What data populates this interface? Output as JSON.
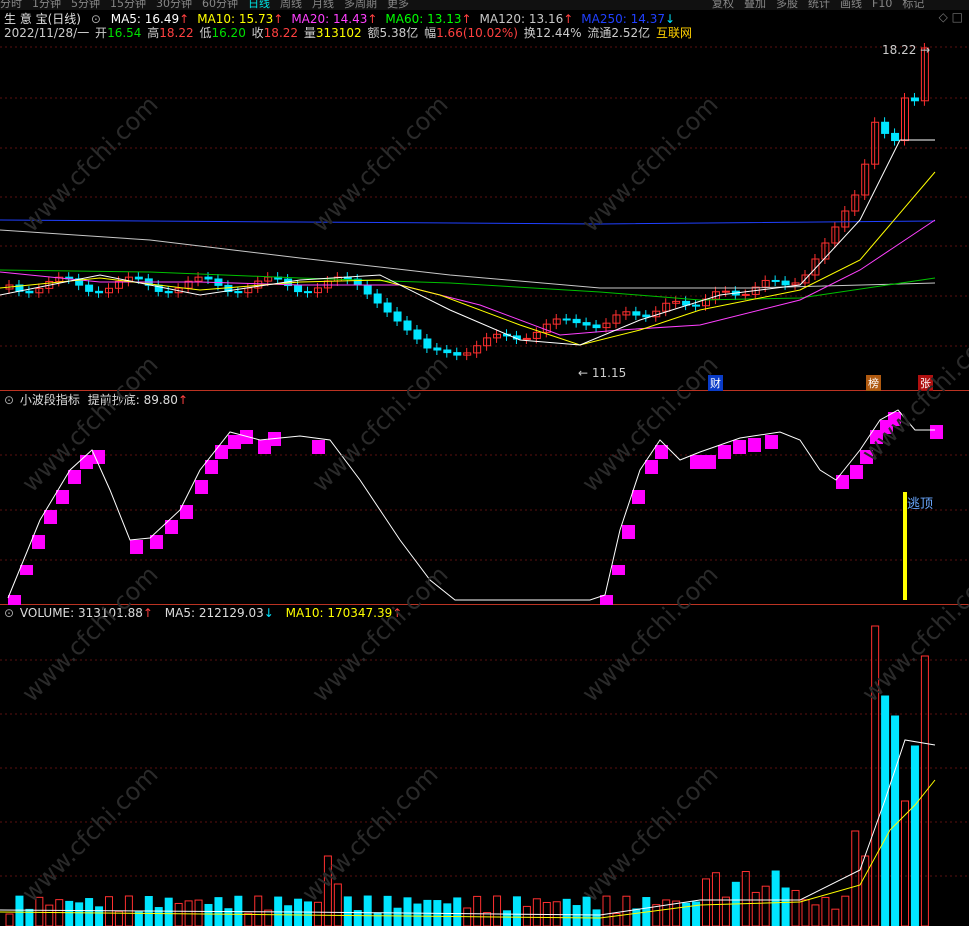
{
  "topbar": {
    "tabs": [
      "分时",
      "1分钟",
      "5分钟",
      "15分钟",
      "30分钟",
      "60分钟",
      "日线",
      "周线",
      "月线",
      "多周期",
      "更多"
    ],
    "right_tabs": [
      "复权",
      "叠加",
      "多股",
      "统计",
      "画线",
      "F10",
      "标记"
    ]
  },
  "header": {
    "stock_name": "生 意 宝(日线)",
    "ma": [
      {
        "label": "MA5: 16.49",
        "arrow": "↑",
        "color": "#ffffff"
      },
      {
        "label": "MA10: 15.73",
        "arrow": "↑",
        "color": "#ffff00"
      },
      {
        "label": "MA20: 14.43",
        "arrow": "↑",
        "color": "#ff40ff"
      },
      {
        "label": "MA60: 13.13",
        "arrow": "↑",
        "color": "#00ff00"
      },
      {
        "label": "MA120: 13.16",
        "arrow": "↑",
        "color": "#c8c8c8"
      },
      {
        "label": "MA250: 14.37",
        "arrow": "↓",
        "color": "#2040ff"
      }
    ]
  },
  "quote": {
    "date": "2022/11/28/一",
    "open_label": "开",
    "open": "16.54",
    "high_label": "高",
    "high": "18.22",
    "low_label": "低",
    "low": "16.20",
    "close_label": "收",
    "close": "18.22",
    "vol_label": "量",
    "vol": "313102",
    "amount_label": "额",
    "amount": "5.38亿",
    "chg_label": "幅",
    "chg": "1.66(10.02%)",
    "turnover_label": "换",
    "turnover": "12.44%",
    "float_label": "流通",
    "float": "2.52亿",
    "source": "互联网"
  },
  "price_chart": {
    "high_marker": "18.22",
    "low_marker": "11.15",
    "badges": [
      "财",
      "榜",
      "张"
    ]
  },
  "indicator": {
    "title": "小波段指标",
    "subtitle": "提前抄底: 89.80",
    "arrow": "↑",
    "signal_label": "逃顶"
  },
  "volume": {
    "label": "VOLUME: 313101.88",
    "ma5": "MA5: 212129.03",
    "ma5_arrow": "↓",
    "ma10": "MA10: 170347.39",
    "ma10_arrow": "↑"
  },
  "watermark": "www.cfchi.com",
  "colors": {
    "up": "#ff3030",
    "down": "#00e5ff",
    "indicator": "#ff00ff",
    "signal": "#ffff00"
  }
}
